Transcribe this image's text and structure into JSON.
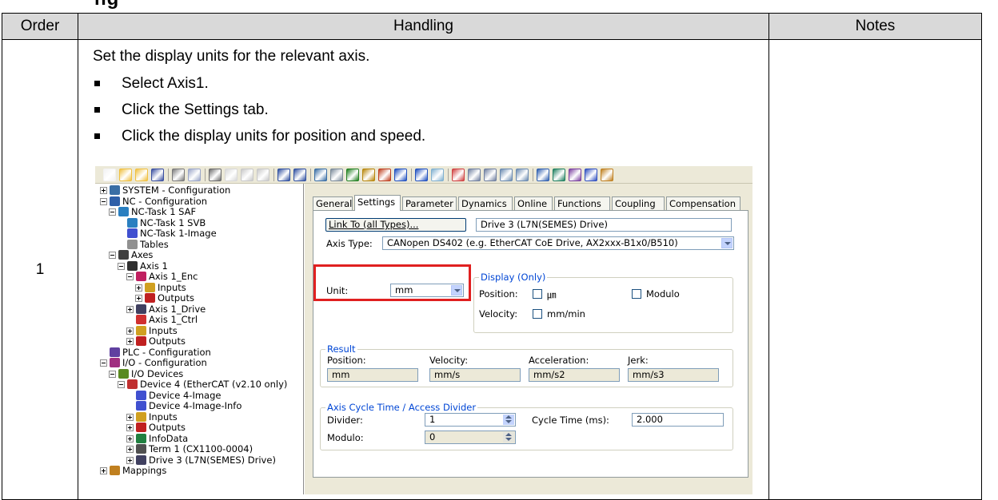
{
  "heading_fragment": "ng",
  "table": {
    "headers": [
      "Order",
      "Handling",
      "Notes"
    ],
    "row": {
      "order": "1",
      "intro": "Set the display units for the relevant axis.",
      "steps": [
        "Select Axis1.",
        "Click the Settings tab.",
        "Click the display units for position and speed."
      ],
      "notes": ""
    }
  },
  "screenshot": {
    "toolbar_icons": [
      "new-icon",
      "open-icon",
      "open-folder-icon",
      "save-icon",
      "print-icon",
      "print-preview-icon",
      "cut-icon",
      "copy-icon",
      "paste-icon",
      "paste-special-icon",
      "find-icon",
      "find-next-icon",
      "monitor-icon",
      "generate-mappings-icon",
      "check-icon",
      "activate-config-icon",
      "restart-icon",
      "config-mode-icon",
      "scan-icon",
      "toggle-free-run-icon",
      "target-icon",
      "zoom-out-icon",
      "zoom-in-icon",
      "show-online-icon",
      "goggles-icon",
      "axis-icon",
      "axis-online-icon",
      "settings-icon",
      "help-icon",
      "about-icon"
    ],
    "tree": [
      {
        "label": "SYSTEM - Configuration",
        "level": 0,
        "exp": "plus",
        "icon": "system-config-icon"
      },
      {
        "label": "NC - Configuration",
        "level": 0,
        "exp": "minus",
        "icon": "nc-config-icon"
      },
      {
        "label": "NC-Task 1 SAF",
        "level": 1,
        "exp": "minus",
        "icon": "task-icon"
      },
      {
        "label": "NC-Task 1 SVB",
        "level": 2,
        "exp": "",
        "icon": "task-icon"
      },
      {
        "label": "NC-Task 1-Image",
        "level": 2,
        "exp": "",
        "icon": "image-icon"
      },
      {
        "label": "Tables",
        "level": 2,
        "exp": "",
        "icon": "table-icon"
      },
      {
        "label": "Axes",
        "level": 1,
        "exp": "minus",
        "icon": "axes-icon"
      },
      {
        "label": "Axis 1",
        "level": 2,
        "exp": "minus",
        "icon": "axis-icon"
      },
      {
        "label": "Axis 1_Enc",
        "level": 3,
        "exp": "minus",
        "icon": "encoder-icon"
      },
      {
        "label": "Inputs",
        "level": 4,
        "exp": "plus",
        "icon": "inputs-icon"
      },
      {
        "label": "Outputs",
        "level": 4,
        "exp": "plus",
        "icon": "outputs-icon"
      },
      {
        "label": "Axis 1_Drive",
        "level": 3,
        "exp": "plus",
        "icon": "drive-icon"
      },
      {
        "label": "Axis 1_Ctrl",
        "level": 3,
        "exp": "",
        "icon": "controller-icon"
      },
      {
        "label": "Inputs",
        "level": 3,
        "exp": "plus",
        "icon": "inputs-icon"
      },
      {
        "label": "Outputs",
        "level": 3,
        "exp": "plus",
        "icon": "outputs-icon"
      },
      {
        "label": "PLC - Configuration",
        "level": 0,
        "exp": "",
        "icon": "plc-config-icon"
      },
      {
        "label": "I/O - Configuration",
        "level": 0,
        "exp": "minus",
        "icon": "io-config-icon"
      },
      {
        "label": "I/O Devices",
        "level": 1,
        "exp": "minus",
        "icon": "io-devices-icon"
      },
      {
        "label": "Device 4 (EtherCAT (v2.10 only)",
        "level": 2,
        "exp": "minus",
        "icon": "ethercat-icon"
      },
      {
        "label": "Device 4-Image",
        "level": 3,
        "exp": "",
        "icon": "image-icon"
      },
      {
        "label": "Device 4-Image-Info",
        "level": 3,
        "exp": "",
        "icon": "image-icon"
      },
      {
        "label": "Inputs",
        "level": 3,
        "exp": "plus",
        "icon": "inputs-icon"
      },
      {
        "label": "Outputs",
        "level": 3,
        "exp": "plus",
        "icon": "outputs-icon"
      },
      {
        "label": "InfoData",
        "level": 3,
        "exp": "plus",
        "icon": "infodata-icon"
      },
      {
        "label": "Term 1 (CX1100-0004)",
        "level": 3,
        "exp": "plus",
        "icon": "terminal-icon"
      },
      {
        "label": "Drive 3 (L7N(SEMES) Drive)",
        "level": 3,
        "exp": "plus",
        "icon": "drive-icon"
      },
      {
        "label": "Mappings",
        "level": 0,
        "exp": "plus",
        "icon": "mappings-icon"
      }
    ],
    "tabs": [
      "General",
      "Settings",
      "Parameter",
      "Dynamics",
      "Online",
      "Functions",
      "Coupling",
      "Compensation"
    ],
    "active_tab": "Settings",
    "link_button": "Link To (all Types)...",
    "link_value": "Drive 3 (L7N(SEMES) Drive)",
    "axis_type_label": "Axis Type:",
    "axis_type_value": "CANopen DS402  (e.g. EtherCAT CoE Drive, AX2xxx-B1x0/B510)",
    "unit_label": "Unit:",
    "unit_value": "mm",
    "display_group": "Display (Only)",
    "display_position_label": "Position:",
    "display_position_option": "㎛",
    "display_modulo": "Modulo",
    "display_velocity_label": "Velocity:",
    "display_velocity_option": "mm/min",
    "result_group": "Result",
    "result_headers": [
      "Position:",
      "Velocity:",
      "Acceleration:",
      "Jerk:"
    ],
    "result_values": [
      "mm",
      "mm/s",
      "mm/s2",
      "mm/s3"
    ],
    "cycle_group": "Axis Cycle Time / Access Divider",
    "divider_label": "Divider:",
    "divider_value": "1",
    "cycle_time_label": "Cycle Time (ms):",
    "cycle_time_value": "2.000",
    "modulo_label": "Modulo:",
    "modulo_value": "0",
    "highlight_color": "#e02020"
  }
}
